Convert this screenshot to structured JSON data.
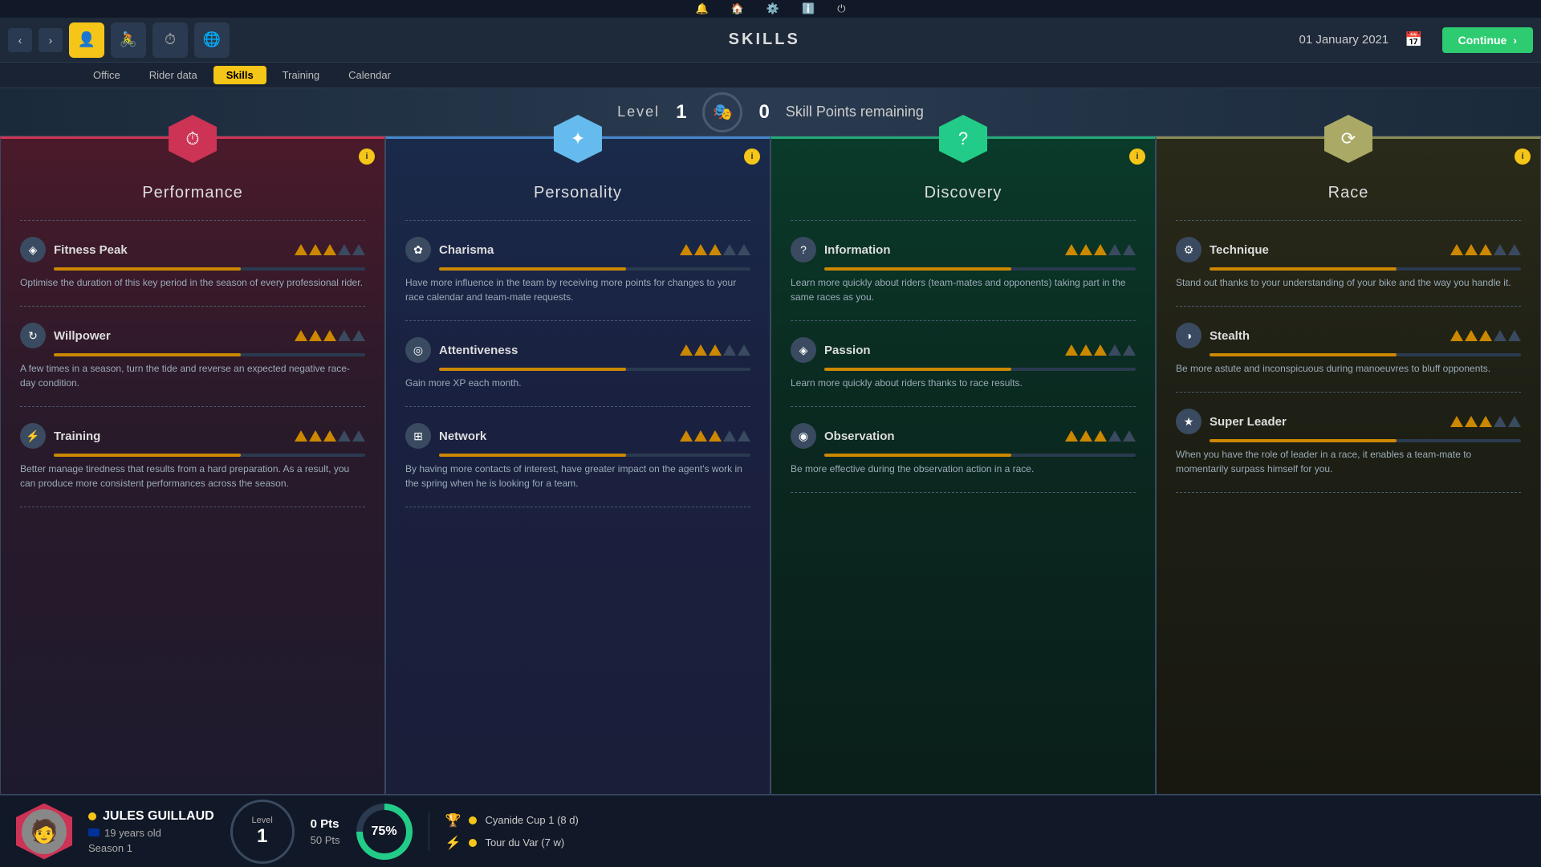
{
  "topbar": {
    "icons": [
      "🔔",
      "🏠",
      "⚙️",
      "ℹ️",
      "⏻"
    ]
  },
  "navbar": {
    "title": "SKILLS",
    "date": "01 January 2021",
    "continue_label": "Continue"
  },
  "tabs": [
    {
      "label": "Office",
      "active": false
    },
    {
      "label": "Rider data",
      "active": false
    },
    {
      "label": "Skills",
      "active": true
    },
    {
      "label": "Training",
      "active": false
    },
    {
      "label": "Calendar",
      "active": false
    }
  ],
  "level_banner": {
    "level_label": "Level",
    "level_value": "1",
    "skill_points_value": "0",
    "skill_points_label": "Skill Points remaining"
  },
  "cards": [
    {
      "id": "performance",
      "title": "Performance",
      "color_class": "performance",
      "hex_class": "hex-performance",
      "icon": "⏱",
      "skills": [
        {
          "name": "Fitness Peak",
          "icon": "◈",
          "stars": 3,
          "max_stars": 5,
          "bar_pct": 60,
          "desc": "Optimise the duration of this key period in the season of every professional rider."
        },
        {
          "name": "Willpower",
          "icon": "↻",
          "stars": 3,
          "max_stars": 5,
          "bar_pct": 60,
          "desc": "A few times in a season, turn the tide and reverse an expected negative race-day condition."
        },
        {
          "name": "Training",
          "icon": "⚡",
          "stars": 3,
          "max_stars": 5,
          "bar_pct": 60,
          "desc": "Better manage tiredness that results from a hard preparation. As a result, you can produce more consistent performances across the season."
        }
      ]
    },
    {
      "id": "personality",
      "title": "Personality",
      "color_class": "personality",
      "hex_class": "hex-personality",
      "icon": "✦",
      "skills": [
        {
          "name": "Charisma",
          "icon": "✿",
          "stars": 3,
          "max_stars": 5,
          "bar_pct": 60,
          "desc": "Have more influence in the team by receiving more points for changes to your race calendar and team-mate requests."
        },
        {
          "name": "Attentiveness",
          "icon": "◎",
          "stars": 3,
          "max_stars": 5,
          "bar_pct": 60,
          "desc": "Gain more XP each month."
        },
        {
          "name": "Network",
          "icon": "⊞",
          "stars": 3,
          "max_stars": 5,
          "bar_pct": 60,
          "desc": "By having more contacts of interest, have greater impact on the agent's work in the spring when he is looking for a team."
        }
      ]
    },
    {
      "id": "discovery",
      "title": "Discovery",
      "color_class": "discovery",
      "hex_class": "hex-discovery",
      "icon": "?",
      "skills": [
        {
          "name": "Information",
          "icon": "?",
          "stars": 3,
          "max_stars": 5,
          "bar_pct": 60,
          "desc": "Learn more quickly about riders (team-mates and opponents) taking part in the same races as you."
        },
        {
          "name": "Passion",
          "icon": "◈",
          "stars": 3,
          "max_stars": 5,
          "bar_pct": 60,
          "desc": "Learn more quickly about riders thanks to race results."
        },
        {
          "name": "Observation",
          "icon": "◉",
          "stars": 3,
          "max_stars": 5,
          "bar_pct": 60,
          "desc": "Be more effective during the observation action in a race."
        }
      ]
    },
    {
      "id": "race",
      "title": "Race",
      "color_class": "race",
      "hex_class": "hex-race",
      "icon": "⟳",
      "skills": [
        {
          "name": "Technique",
          "icon": "⚙",
          "stars": 3,
          "max_stars": 5,
          "bar_pct": 60,
          "desc": "Stand out thanks to your understanding of your bike and the way you handle it."
        },
        {
          "name": "Stealth",
          "icon": "◑",
          "stars": 3,
          "max_stars": 5,
          "bar_pct": 60,
          "desc": "Be more astute and inconspicuous during manoeuvres to bluff opponents."
        },
        {
          "name": "Super Leader",
          "icon": "★",
          "stars": 3,
          "max_stars": 5,
          "bar_pct": 60,
          "desc": "When you have the role of leader in a race, it enables a team-mate to momentarily surpass himself for you."
        }
      ]
    }
  ],
  "bottombar": {
    "player_name": "JULES GUILLAUD",
    "player_age": "19 years old",
    "player_season": "Season 1",
    "level_label": "Level",
    "level_value": "1",
    "pts_current": "0 Pts",
    "pts_total": "50 Pts",
    "progress_pct": "75%",
    "races": [
      {
        "icon": "🏆",
        "label": "Cyanide Cup 1 (8 d)"
      },
      {
        "icon": "⚡",
        "label": "Tour du Var (7 w)"
      }
    ]
  }
}
